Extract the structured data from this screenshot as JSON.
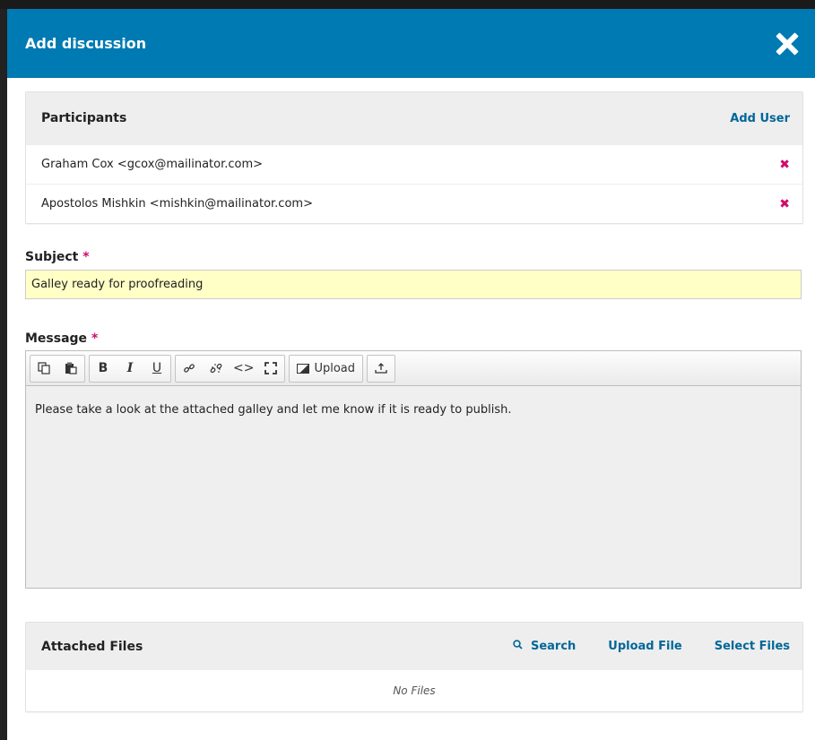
{
  "modal": {
    "title": "Add discussion"
  },
  "participants": {
    "title": "Participants",
    "add_user_label": "Add User",
    "rows": [
      {
        "text": "Graham Cox <gcox@mailinator.com>",
        "remove_glyph": "✖"
      },
      {
        "text": "Apostolos Mishkin <mishkin@mailinator.com>",
        "remove_glyph": "✖"
      }
    ]
  },
  "subject": {
    "label": "Subject",
    "required_mark": "*",
    "value": "Galley ready for proofreading"
  },
  "message": {
    "label": "Message",
    "required_mark": "*",
    "toolbar": {
      "copy_icon": "copy-icon",
      "paste_icon": "paste-icon",
      "bold": "B",
      "italic": "I",
      "underline": "U",
      "link_glyph": "🔗",
      "unlink_glyph": "⛓",
      "code_glyph": "<>",
      "fullscreen_glyph": "⛶",
      "upload_label": "Upload",
      "insert_glyph": "⤒"
    },
    "body": "Please take a look at the attached galley and let me know if it is ready to publish."
  },
  "attached_files": {
    "title": "Attached Files",
    "search_label": "Search",
    "upload_label": "Upload File",
    "select_label": "Select Files",
    "empty_text": "No Files"
  },
  "colors": {
    "header_bg": "#007ab2",
    "link": "#006798",
    "required": "#d00a6c",
    "subject_bg": "#ffffc6"
  }
}
